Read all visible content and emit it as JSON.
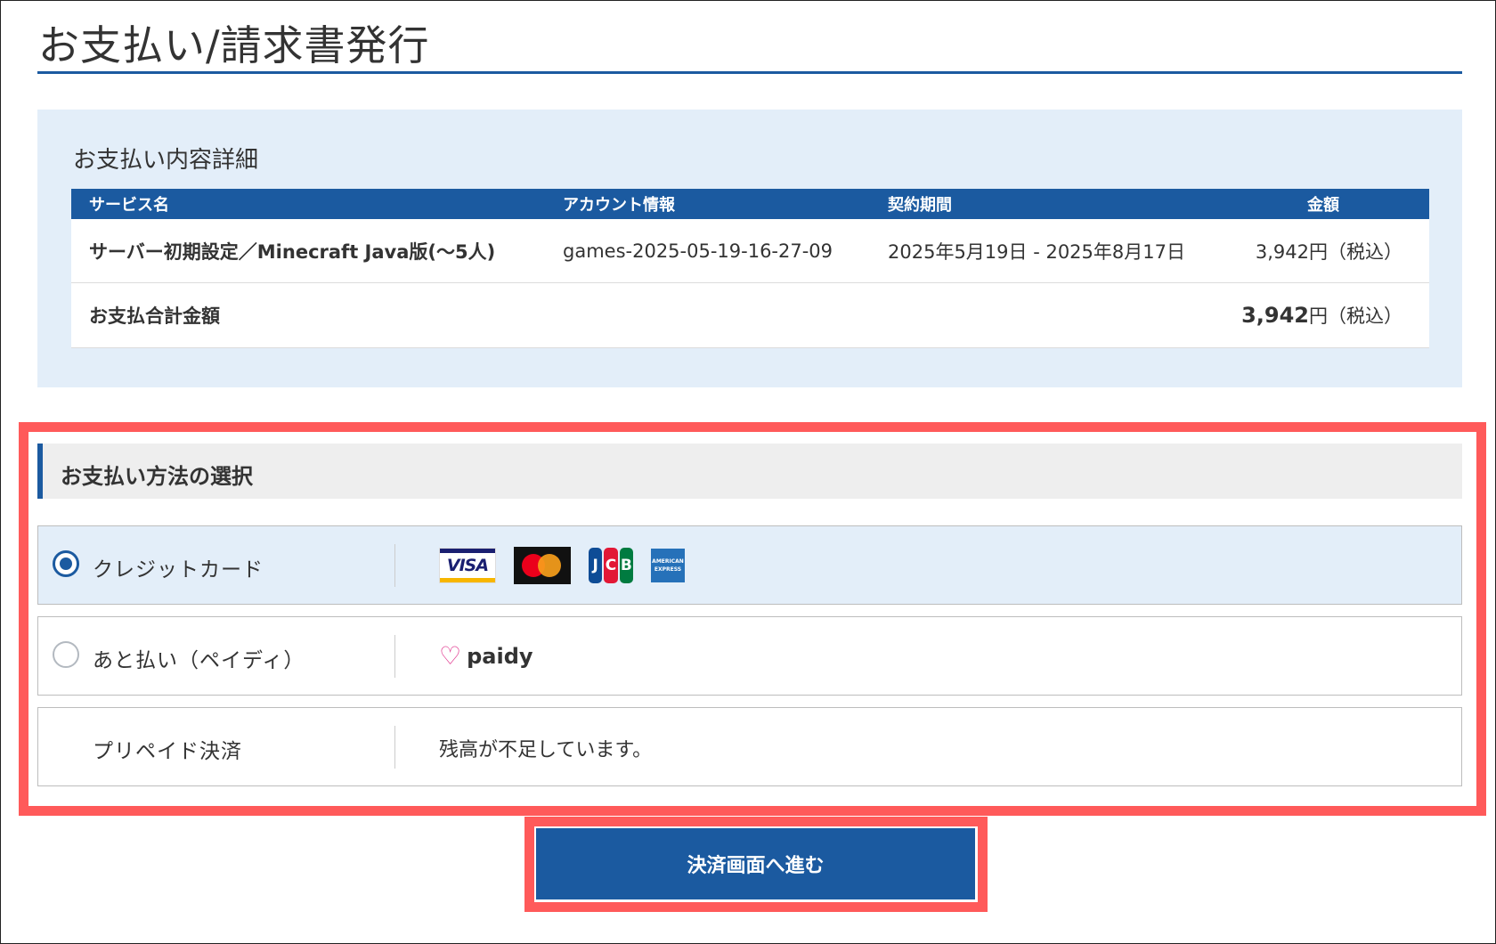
{
  "page": {
    "title": "お支払い/請求書発行"
  },
  "details": {
    "heading": "お支払い内容詳細",
    "columns": {
      "service": "サービス名",
      "account": "アカウント情報",
      "period": "契約期間",
      "amount": "金額"
    },
    "row": {
      "service": "サーバー初期設定／Minecraft Java版(〜5人)",
      "account": "games-2025-05-19-16-27-09",
      "period": "2025年5月19日 - 2025年8月17日",
      "amount": "3,942円（税込）"
    },
    "total": {
      "label": "お支払合計金額",
      "amount_value": "3,942",
      "amount_suffix": "円（税込）"
    }
  },
  "payment": {
    "heading": "お支払い方法の選択",
    "methods": [
      {
        "label": "クレジットカード",
        "selected": true
      },
      {
        "label": "あと払い（ペイディ）",
        "selected": false
      },
      {
        "label": "プリペイド決済",
        "note": "残高が不足しています。"
      }
    ],
    "card_logos": [
      {
        "name": "visa-logo-icon",
        "text": "VISA"
      },
      {
        "name": "mastercard-logo-icon"
      },
      {
        "name": "jcb-logo-icon",
        "text": "JCB"
      },
      {
        "name": "amex-logo-icon",
        "text": "AMERICAN EXPRESS"
      }
    ],
    "paidy_logo": {
      "text": "paidy"
    }
  },
  "actions": {
    "proceed_label": "決済画面へ進む"
  },
  "colors": {
    "primary": "#1b5aa0",
    "highlight": "#ff5a5a",
    "panel": "#e3eef9"
  }
}
